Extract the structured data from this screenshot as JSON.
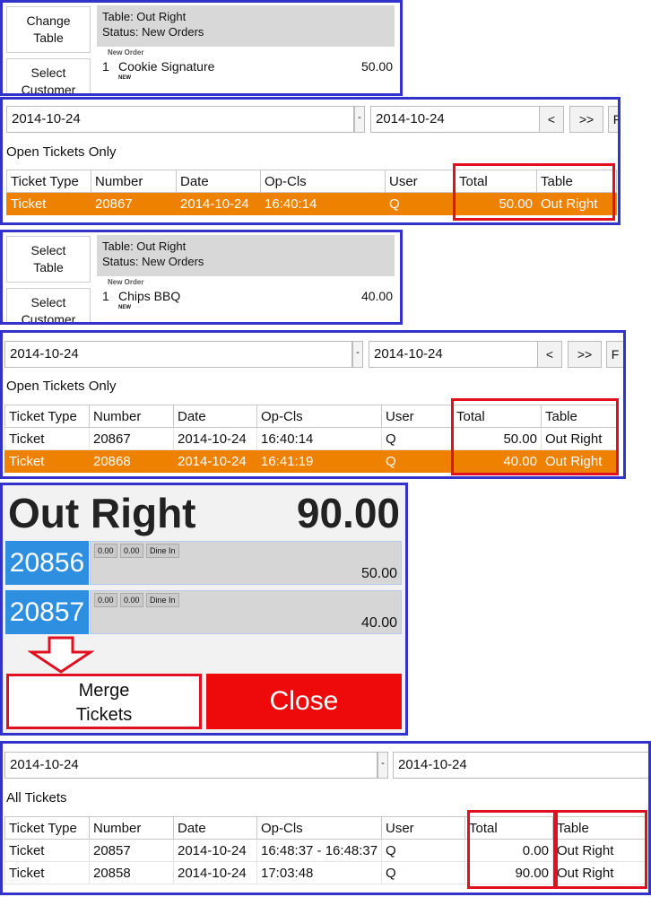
{
  "panel1": {
    "buttons": [
      "Change Table",
      "Select Customer"
    ],
    "status_table": "Table: Out Right",
    "status_state": "Status: New Orders",
    "order_header": "New Order",
    "item": {
      "qty": "1",
      "name": "Cookie Signature",
      "price": "50.00",
      "tag": "NEW"
    }
  },
  "panel2": {
    "date_from": "2014-10-24",
    "date_to": "2014-10-24",
    "arrow": "-",
    "nav_prev": "<",
    "nav_next": ">>",
    "nav_extra": "F",
    "filter": "Open Tickets Only",
    "columns": [
      "Ticket Type",
      "Number",
      "Date",
      "Op-Cls",
      "User",
      "Total",
      "Table"
    ],
    "rows": [
      {
        "type": "Ticket",
        "number": "20867",
        "date": "2014-10-24",
        "opcls": "16:40:14",
        "user": "Q",
        "total": "50.00",
        "table": "Out Right"
      }
    ]
  },
  "panel3": {
    "buttons": [
      "Select Table",
      "Select Customer"
    ],
    "status_table": "Table: Out Right",
    "status_state": "Status: New Orders",
    "order_header": "New Order",
    "item": {
      "qty": "1",
      "name": "Chips BBQ",
      "price": "40.00",
      "tag": "NEW"
    }
  },
  "panel4": {
    "date_from": "2014-10-24",
    "date_to": "2014-10-24",
    "arrow": "-",
    "nav_prev": "<",
    "nav_next": ">>",
    "nav_extra": "F",
    "filter": "Open Tickets Only",
    "columns": [
      "Ticket Type",
      "Number",
      "Date",
      "Op-Cls",
      "User",
      "Total",
      "Table"
    ],
    "rows": [
      {
        "type": "Ticket",
        "number": "20867",
        "date": "2014-10-24",
        "opcls": "16:40:14",
        "user": "Q",
        "total": "50.00",
        "table": "Out Right"
      },
      {
        "type": "Ticket",
        "number": "20868",
        "date": "2014-10-24",
        "opcls": "16:41:19",
        "user": "Q",
        "total": "40.00",
        "table": "Out Right"
      }
    ]
  },
  "panel5": {
    "title": "Out Right",
    "total": "90.00",
    "tickets": [
      {
        "number": "20856",
        "chips": [
          "0.00",
          "0.00",
          "Dine In"
        ],
        "amount": "50.00"
      },
      {
        "number": "20857",
        "chips": [
          "0.00",
          "0.00",
          "Dine In"
        ],
        "amount": "40.00"
      }
    ],
    "merge_label_1": "Merge",
    "merge_label_2": "Tickets",
    "close_label": "Close"
  },
  "panel6": {
    "date_from": "2014-10-24",
    "date_to": "2014-10-24",
    "arrow": "-",
    "filter": "All Tickets",
    "columns": [
      "Ticket Type",
      "Number",
      "Date",
      "Op-Cls",
      "User",
      "Total",
      "Table"
    ],
    "rows": [
      {
        "type": "Ticket",
        "number": "20857",
        "date": "2014-10-24",
        "opcls": "16:48:37 - 16:48:37",
        "user": "Q",
        "total": "0.00",
        "table": "Out Right"
      },
      {
        "type": "Ticket",
        "number": "20858",
        "date": "2014-10-24",
        "opcls": "17:03:48",
        "user": "Q",
        "total": "90.00",
        "table": "Out Right"
      }
    ]
  }
}
